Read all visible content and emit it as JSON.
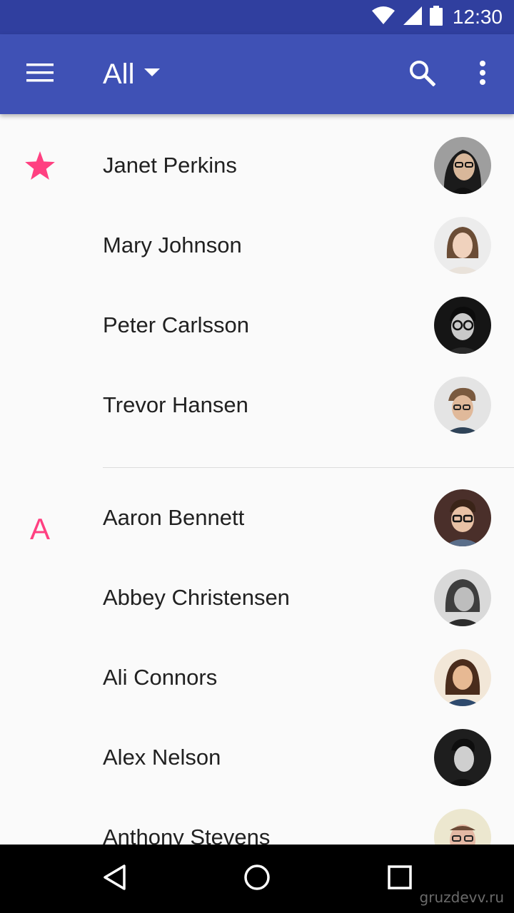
{
  "status_bar": {
    "time": "12:30",
    "icons": [
      "wifi-icon",
      "cell-signal-icon",
      "battery-icon"
    ]
  },
  "app_bar": {
    "title": "All",
    "icons": [
      "menu-icon",
      "dropdown-arrow-icon",
      "search-icon",
      "more-vert-icon"
    ],
    "color": "#3f51b5",
    "status_color": "#303f9f"
  },
  "accent_color": "#ff4081",
  "favorites": {
    "marker_icon": "star-icon",
    "contacts": [
      {
        "name": "Janet Perkins"
      },
      {
        "name": "Mary Johnson"
      },
      {
        "name": "Peter Carlsson"
      },
      {
        "name": "Trevor Hansen"
      }
    ]
  },
  "section_a": {
    "letter": "A",
    "contacts": [
      {
        "name": "Aaron Bennett"
      },
      {
        "name": "Abbey Christensen"
      },
      {
        "name": "Ali Connors"
      },
      {
        "name": "Alex Nelson"
      },
      {
        "name": "Anthony Stevens"
      }
    ]
  },
  "nav_bar": {
    "icons": [
      "back-icon",
      "home-icon",
      "recents-icon"
    ]
  },
  "watermark": "gruzdevv.ru"
}
